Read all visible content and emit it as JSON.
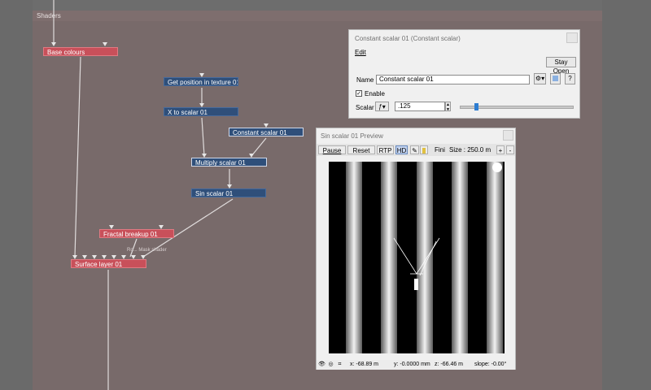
{
  "panel": {
    "title": "Shaders"
  },
  "nodes": {
    "base_colours": "Base colours",
    "get_position": "Get position in texture 01",
    "x_to_scalar": "X to scalar 01",
    "constant_scalar": "Constant scalar 01",
    "multiply_scalar": "Multiply scalar 01",
    "sin_scalar": "Sin scalar 01",
    "fractal_breakup": "Fractal breakup 01",
    "fractal_sublabel": "Ro... Mask shader",
    "surface_layer": "Surface layer 01"
  },
  "dialog": {
    "title": "Constant scalar 01    (Constant scalar)",
    "menu_edit": "Edit",
    "stay_open": "Stay Open",
    "name_label": "Name",
    "name_value": "Constant scalar 01",
    "enable_label": "Enable",
    "enable_checked": true,
    "scalar_label": "Scalar",
    "scalar_value": ".125",
    "slider_value": 0.13,
    "help": "?"
  },
  "preview": {
    "title": "Sin scalar 01 Preview",
    "toolbar": {
      "pause": "Pause",
      "reset": "Reset",
      "rtp": "RTP",
      "hd": "HD",
      "fini": "Fini",
      "size": "Size : 250.0 m",
      "zoom_in": "+",
      "zoom_out": "-"
    },
    "status": {
      "x": "x: -68.89 m",
      "y": "y: -0.0000 mm",
      "z": "z: -66.46 m",
      "slope": "slope: -0.00°"
    }
  },
  "colors": {
    "panel_bg": "#786a6a",
    "node_red": "#c8505a",
    "node_blue": "#2f4f7a",
    "accent": "#2d7dd2"
  },
  "icons": [
    "gear-icon",
    "color-swatch-icon",
    "help-icon",
    "crosshair-icon",
    "sun-icon",
    "eye-icon",
    "layers-icon"
  ]
}
